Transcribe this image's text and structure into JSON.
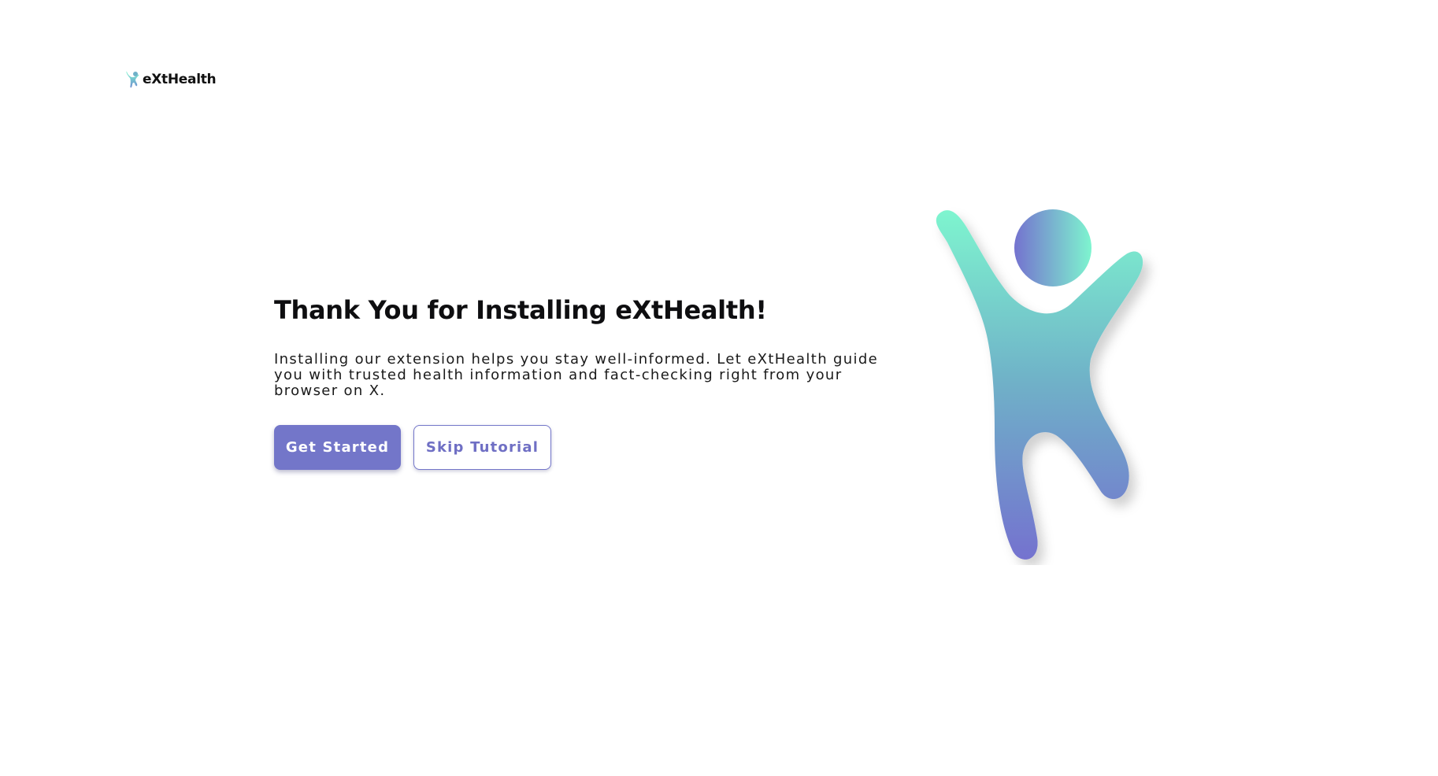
{
  "brand": {
    "name": "eXtHealth",
    "logo_icon": "person-cheering-icon"
  },
  "hero": {
    "title": "Thank You for Installing eXtHealth!",
    "description": "Installing our extension helps you stay well-informed. Let eXtHealth guide you with trusted health information and fact-checking right from your browser on X.",
    "illustration_icon": "person-cheering-illustration"
  },
  "actions": {
    "primary_label": "Get Started",
    "secondary_label": "Skip Tutorial"
  },
  "colors": {
    "accent": "#7376c9",
    "gradient_top": "#7ef5cf",
    "gradient_mid": "#6fb0c8",
    "gradient_bottom": "#7472cf",
    "background": "#ffffff"
  }
}
